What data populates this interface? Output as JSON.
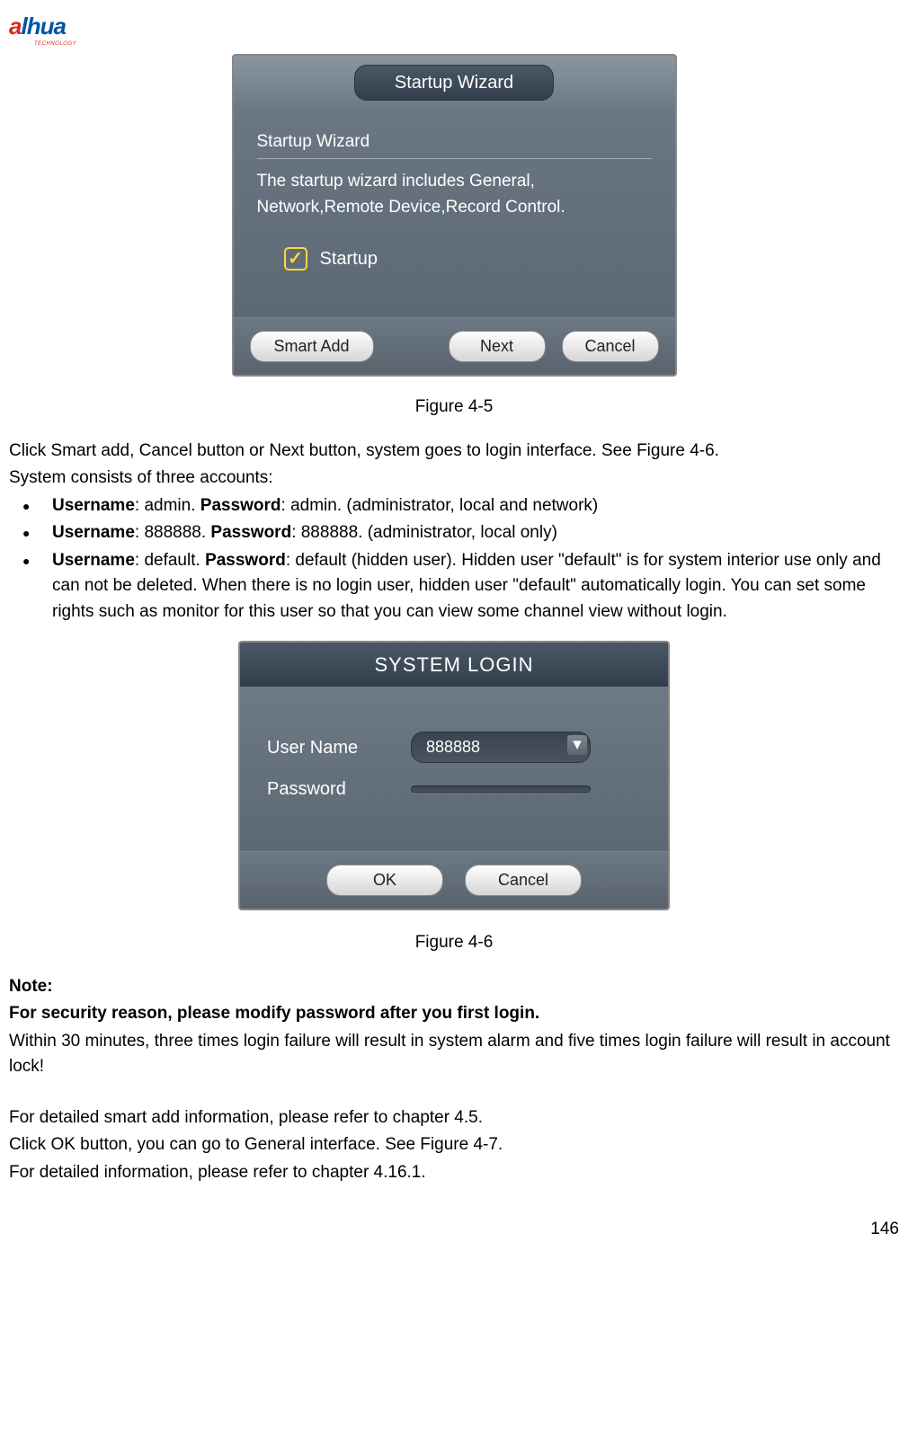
{
  "logo": {
    "main_a": "a",
    "main_rest": "lhua",
    "sub": "TECHNOLOGY"
  },
  "wizard": {
    "title": "Startup Wizard",
    "section_label": "Startup Wizard",
    "description": "The startup wizard includes General, Network,Remote Device,Record Control.",
    "checkbox_label": "Startup",
    "smart_add": "Smart Add",
    "next": "Next",
    "cancel": "Cancel"
  },
  "caption1": "Figure 4-5",
  "body1": {
    "p1": "Click Smart add, Cancel button or Next button, system goes to login interface. See Figure 4-6.",
    "p2": "System consists of three accounts:"
  },
  "bullets": [
    {
      "u_label": "Username",
      "u_val": ": admin.   ",
      "p_label": "Password",
      "p_val": ": admin. (administrator, local and network)"
    },
    {
      "u_label": "Username",
      "u_val": ": 888888. ",
      "p_label": "Password",
      "p_val": ": 888888. (administrator, local only)"
    },
    {
      "u_label": "Username",
      "u_val": ": default. ",
      "p_label": "Password",
      "p_val": ": default (hidden user). Hidden user \"default\" is for system interior use only and can not be deleted. When there is no login user, hidden user \"default\" automatically login. You can set some rights such as monitor for this user so that you can view some channel view without login."
    }
  ],
  "login": {
    "title": "SYSTEM LOGIN",
    "username_label": "User Name",
    "username_value": "888888",
    "password_label": "Password",
    "password_value": "",
    "ok": "OK",
    "cancel": "Cancel"
  },
  "caption2": "Figure 4-6",
  "note": {
    "heading": "Note:",
    "bold_line": "For security reason, please modify password after you first login.",
    "p1": "Within 30 minutes, three times login failure will result in system alarm and five times login failure will result in account lock!",
    "p2": "For detailed smart add information, please refer to chapter 4.5.",
    "p3": "Click OK button, you can go to General interface. See Figure 4-7.",
    "p4": "For detailed information, please refer to chapter 4.16.1."
  },
  "page_number": "146"
}
